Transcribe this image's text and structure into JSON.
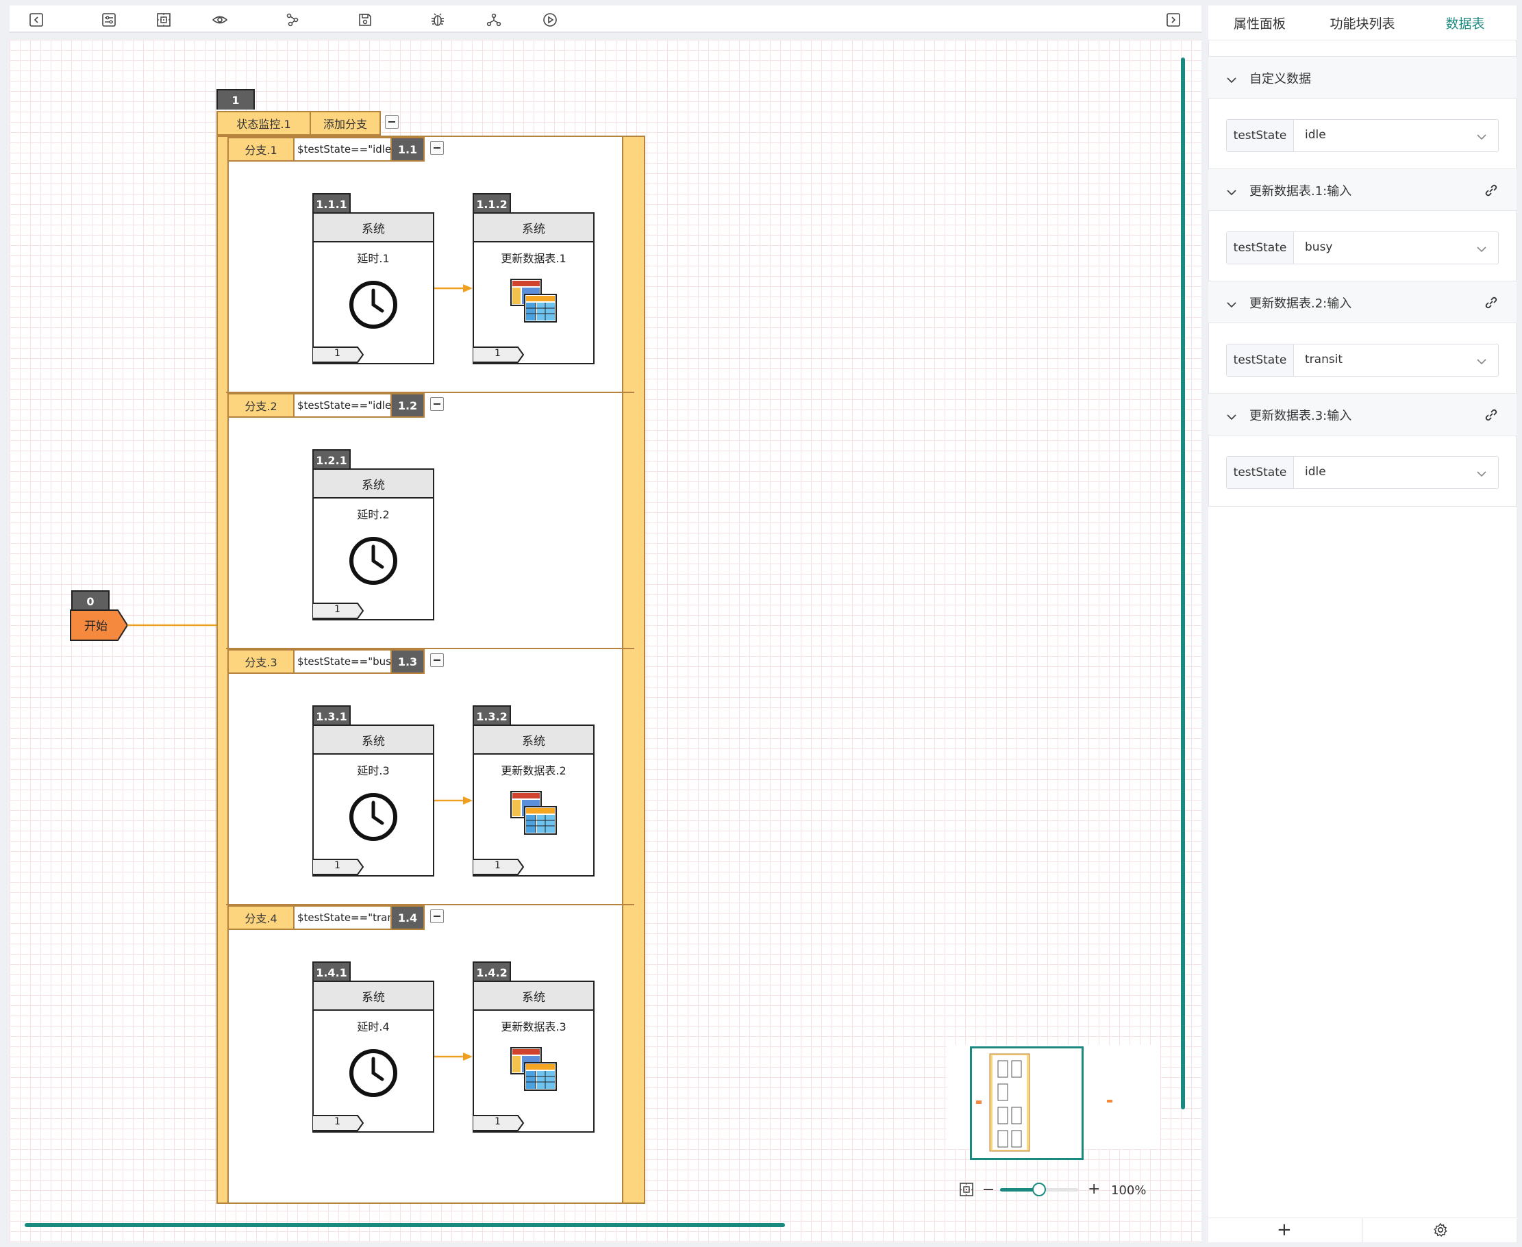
{
  "toolbar": {
    "icons": [
      "collapse-left-icon",
      "adjust-icon",
      "fit-view-icon",
      "preview-icon",
      "workflow-icon",
      "save-icon",
      "debug-icon",
      "topology-icon",
      "run-icon",
      "collapse-right-icon"
    ]
  },
  "flow": {
    "start": {
      "num": "0",
      "label": "开始"
    },
    "monitor": {
      "num": "1",
      "label": "状态监控.1",
      "add_branch": "添加分支"
    },
    "branches": [
      {
        "label": "分支.1",
        "cond": "$testState==\"idle\"",
        "num": "1.1",
        "nodes": [
          {
            "num": "1.1.1",
            "cat": "系统",
            "name": "延时.1",
            "port": "1",
            "icon": "clock-icon"
          },
          {
            "num": "1.1.2",
            "cat": "系统",
            "name": "更新数据表.1",
            "port": "1",
            "icon": "datatable-icon"
          }
        ]
      },
      {
        "label": "分支.2",
        "cond": "$testState==\"idle\"",
        "num": "1.2",
        "nodes": [
          {
            "num": "1.2.1",
            "cat": "系统",
            "name": "延时.2",
            "port": "1",
            "icon": "clock-icon"
          }
        ]
      },
      {
        "label": "分支.3",
        "cond": "$testState==\"busy\"",
        "num": "1.3",
        "nodes": [
          {
            "num": "1.3.1",
            "cat": "系统",
            "name": "延时.3",
            "port": "1",
            "icon": "clock-icon"
          },
          {
            "num": "1.3.2",
            "cat": "系统",
            "name": "更新数据表.2",
            "port": "1",
            "icon": "datatable-icon"
          }
        ]
      },
      {
        "label": "分支.4",
        "cond": "$testState==\"transit\"",
        "num": "1.4",
        "nodes": [
          {
            "num": "1.4.1",
            "cat": "系统",
            "name": "延时.4",
            "port": "1",
            "icon": "clock-icon"
          },
          {
            "num": "1.4.2",
            "cat": "系统",
            "name": "更新数据表.3",
            "port": "1",
            "icon": "datatable-icon"
          }
        ]
      }
    ]
  },
  "zoom": {
    "level": "100%",
    "value": 0.5
  },
  "panel": {
    "tabs": [
      "属性面板",
      "功能块列表",
      "数据表"
    ],
    "active_tab": "数据表",
    "accent": "#1a8a80",
    "sections": [
      {
        "title": "自定义数据",
        "rows": [
          {
            "key": "testState",
            "value": "idle"
          }
        ]
      },
      {
        "title": "更新数据表.1:输入",
        "rows": [
          {
            "key": "testState",
            "value": "busy"
          }
        ]
      },
      {
        "title": "更新数据表.2:输入",
        "rows": [
          {
            "key": "testState",
            "value": "transit"
          }
        ]
      },
      {
        "title": "更新数据表.3:输入",
        "rows": [
          {
            "key": "testState",
            "value": "idle"
          }
        ]
      }
    ]
  }
}
